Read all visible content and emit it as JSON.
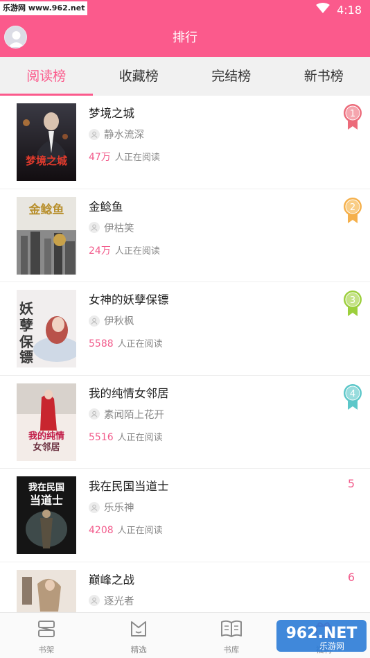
{
  "status_bar": {
    "watermark": "乐游网 www.962.net",
    "time": "4:18"
  },
  "header": {
    "title": "排行"
  },
  "tabs": [
    {
      "label": "阅读榜",
      "active": true
    },
    {
      "label": "收藏榜",
      "active": false
    },
    {
      "label": "完结榜",
      "active": false
    },
    {
      "label": "新书榜",
      "active": false
    }
  ],
  "books": [
    {
      "title": "梦境之城",
      "author": "静水流深",
      "count": "47万",
      "reading_label": "人正在阅读",
      "rank": "1",
      "medal_color": "#ec6b7a",
      "cover_title": "梦境之城"
    },
    {
      "title": "金鲶鱼",
      "author": "伊枯笑",
      "count": "24万",
      "reading_label": "人正在阅读",
      "rank": "2",
      "medal_color": "#f5b04b",
      "cover_title": "金鲶鱼"
    },
    {
      "title": "女神的妖孽保镖",
      "author": "伊秋枫",
      "count": "5588",
      "reading_label": "人正在阅读",
      "rank": "3",
      "medal_color": "#9ccf3c",
      "cover_title": "妖孽保镖"
    },
    {
      "title": "我的纯情女邻居",
      "author": "素闻陌上花开",
      "count": "5516",
      "reading_label": "人正在阅读",
      "rank": "4",
      "medal_color": "#5cc7c9",
      "cover_title": "我的纯情女邻居"
    },
    {
      "title": "我在民国当道士",
      "author": "乐乐神",
      "count": "4208",
      "reading_label": "人正在阅读",
      "rank": "5",
      "medal_color": "",
      "cover_title": "我在民国当道士"
    },
    {
      "title": "巅峰之战",
      "author": "逐光者",
      "count": "",
      "reading_label": "",
      "rank": "6",
      "medal_color": "",
      "cover_title": ""
    }
  ],
  "bottom_nav": [
    {
      "label": "书架",
      "icon": "bookshelf-icon"
    },
    {
      "label": "精选",
      "icon": "featured-icon"
    },
    {
      "label": "书库",
      "icon": "library-icon"
    },
    {
      "label": "福利",
      "icon": "gift-icon"
    }
  ],
  "watermark_logo": {
    "brand": "962.NET",
    "subtitle": "乐游网"
  },
  "colors": {
    "accent": "#fb5a8c",
    "count": "#f25c8c"
  }
}
